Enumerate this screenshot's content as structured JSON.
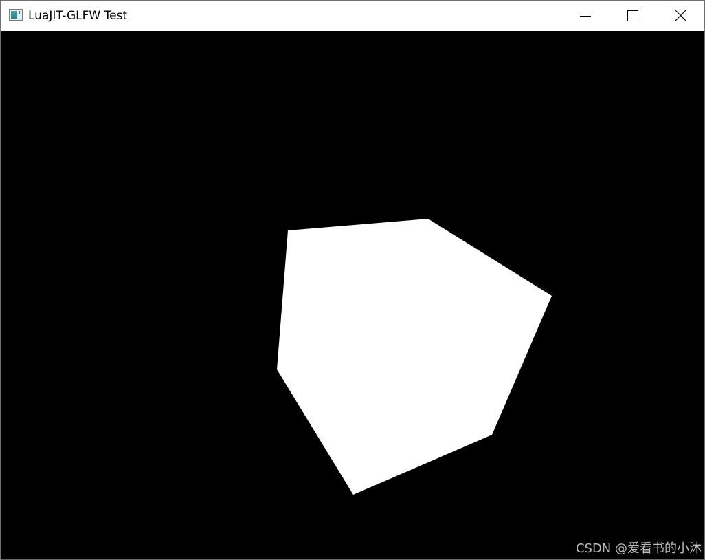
{
  "window": {
    "title": "LuaJIT-GLFW Test",
    "app_icon": "glfw-window-icon",
    "controls": {
      "minimize_icon": "minimize-icon",
      "maximize_icon": "maximize-icon",
      "close_icon": "close-icon"
    }
  },
  "viewport": {
    "background_color": "#000000",
    "shape_color": "#ffffff",
    "shape": "rotating-cube"
  },
  "watermark": "CSDN @爱看书的小沐"
}
